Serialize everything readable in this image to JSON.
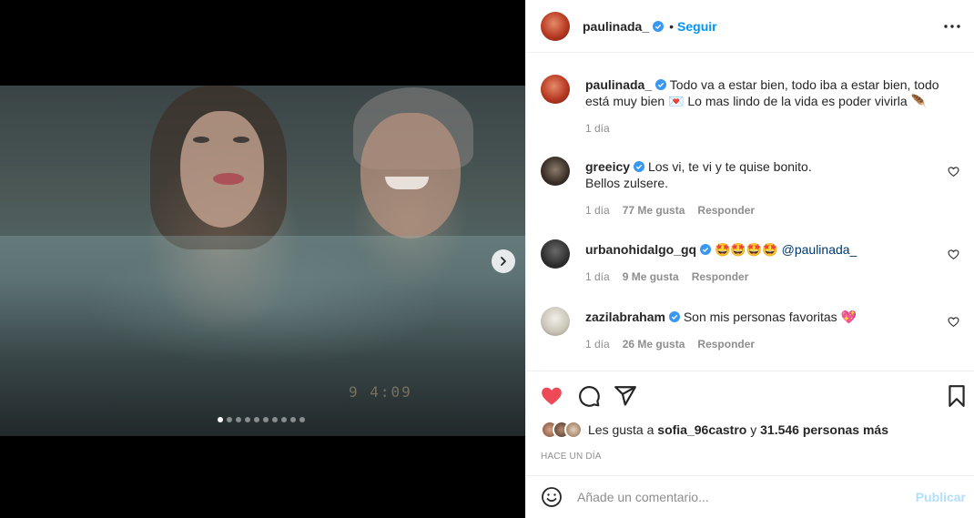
{
  "post": {
    "username": "paulinada_",
    "follow_label": "Seguir",
    "separator": "•",
    "timestamp_overlay": "9   4:09",
    "carousel": {
      "total": 10,
      "active_index": 0
    }
  },
  "caption": {
    "username": "paulinada_",
    "text_1": "Todo va a estar bien, todo iba a estar bien, todo está muy bien",
    "icon_1": "envelope-heart-emoji",
    "glyph_1": "💌",
    "text_2": "Lo mas lindo de la vida es poder vivirla",
    "icon_2": "feather-emoji",
    "glyph_2": "🪶",
    "age": "1 día"
  },
  "comments": [
    {
      "username": "greeicy",
      "text": "Los vi, te vi y te quise bonito.",
      "text_2": "Bellos zulsere.",
      "age": "1 día",
      "likes": "77 Me gusta",
      "reply": "Responder"
    },
    {
      "username": "urbanohidalgo_gq",
      "emojis": "🤩🤩🤩🤩",
      "mention": "@paulinada_",
      "age": "1 día",
      "likes": "9 Me gusta",
      "reply": "Responder"
    },
    {
      "username": "zazilabraham",
      "text": "Son mis personas favoritas",
      "emoji": "💖",
      "age": "1 día",
      "likes": "26 Me gusta",
      "reply": "Responder"
    }
  ],
  "likes": {
    "prefix": "Les gusta a",
    "user": "sofia_96castro",
    "middle": "y",
    "count": "31.546 personas más"
  },
  "posted_ago": "Hace un día",
  "add_comment": {
    "placeholder": "Añade un comentario...",
    "publish_label": "Publicar"
  },
  "colors": {
    "like_red": "#ed4956",
    "link_blue": "#0095f6",
    "publish_disabled": "#b2dffc",
    "verified_blue": "#3897f0"
  }
}
